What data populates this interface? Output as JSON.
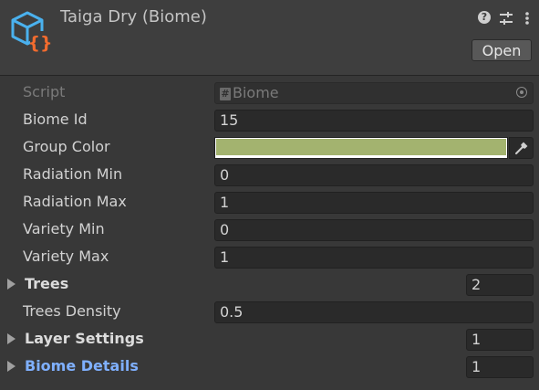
{
  "header": {
    "title": "Taiga Dry (Biome)",
    "open_label": "Open",
    "icons": [
      "scriptable-object-icon",
      "help-icon",
      "presets-icon",
      "kebab-menu-icon"
    ]
  },
  "fields": {
    "script": {
      "label": "Script",
      "value": "Biome"
    },
    "biome_id": {
      "label": "Biome Id",
      "value": "15"
    },
    "group_color": {
      "label": "Group Color",
      "color": "#a3b36f"
    },
    "radiation_min": {
      "label": "Radiation Min",
      "value": "0"
    },
    "radiation_max": {
      "label": "Radiation Max",
      "value": "1"
    },
    "variety_min": {
      "label": "Variety Min",
      "value": "0"
    },
    "variety_max": {
      "label": "Variety Max",
      "value": "1"
    },
    "trees": {
      "label": "Trees",
      "value": "2"
    },
    "trees_density": {
      "label": "Trees Density",
      "value": "0.5"
    },
    "layer_settings": {
      "label": "Layer Settings",
      "value": "1"
    },
    "biome_details": {
      "label": "Biome Details",
      "value": "1"
    }
  },
  "colors": {
    "panel_bg": "#383838",
    "header_bg": "#3e3e3e",
    "link_label": "#7fb0ff",
    "asset_icon_blue": "#4ab1ee",
    "asset_icon_orange": "#f26b2e"
  }
}
